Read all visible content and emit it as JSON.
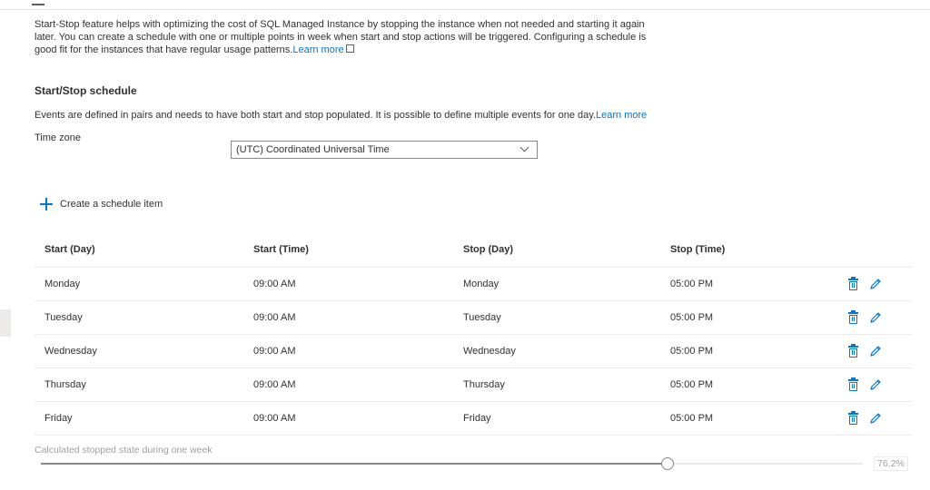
{
  "intro": {
    "text": "Start-Stop feature helps with optimizing the cost of SQL Managed Instance by stopping the instance when not needed and starting it again later. You can create a schedule with one or multiple points in week when start and stop actions will be triggered. Configuring a schedule is good fit for the instances that have regular usage patterns.",
    "learn_more": "Learn more"
  },
  "schedule": {
    "title": "Start/Stop schedule",
    "description": "Events are defined in pairs and needs to have both start and stop populated. It is possible to define multiple events for one day.",
    "learn_more": "Learn more",
    "timezone_label": "Time zone",
    "timezone_value": "(UTC) Coordinated Universal Time",
    "create_label": "Create a schedule item"
  },
  "table": {
    "headers": [
      "Start (Day)",
      "Start (Time)",
      "Stop (Day)",
      "Stop (Time)"
    ],
    "rows": [
      [
        "Monday",
        "09:00 AM",
        "Monday",
        "05:00 PM"
      ],
      [
        "Tuesday",
        "09:00 AM",
        "Tuesday",
        "05:00 PM"
      ],
      [
        "Wednesday",
        "09:00 AM",
        "Wednesday",
        "05:00 PM"
      ],
      [
        "Thursday",
        "09:00 AM",
        "Thursday",
        "05:00 PM"
      ],
      [
        "Friday",
        "09:00 AM",
        "Friday",
        "05:00 PM"
      ]
    ]
  },
  "stopped_state": {
    "label": "Calculated stopped state during one week",
    "value_label": "76.2%",
    "fraction": 0.762
  },
  "icons": {
    "delete": "trash-icon",
    "edit": "pencil-icon",
    "add": "plus-icon",
    "external": "external-link-icon",
    "dropdown": "chevron-down-icon"
  },
  "colors": {
    "accent": "#0078d4",
    "text": "#323130",
    "muted": "#a19f9d"
  }
}
